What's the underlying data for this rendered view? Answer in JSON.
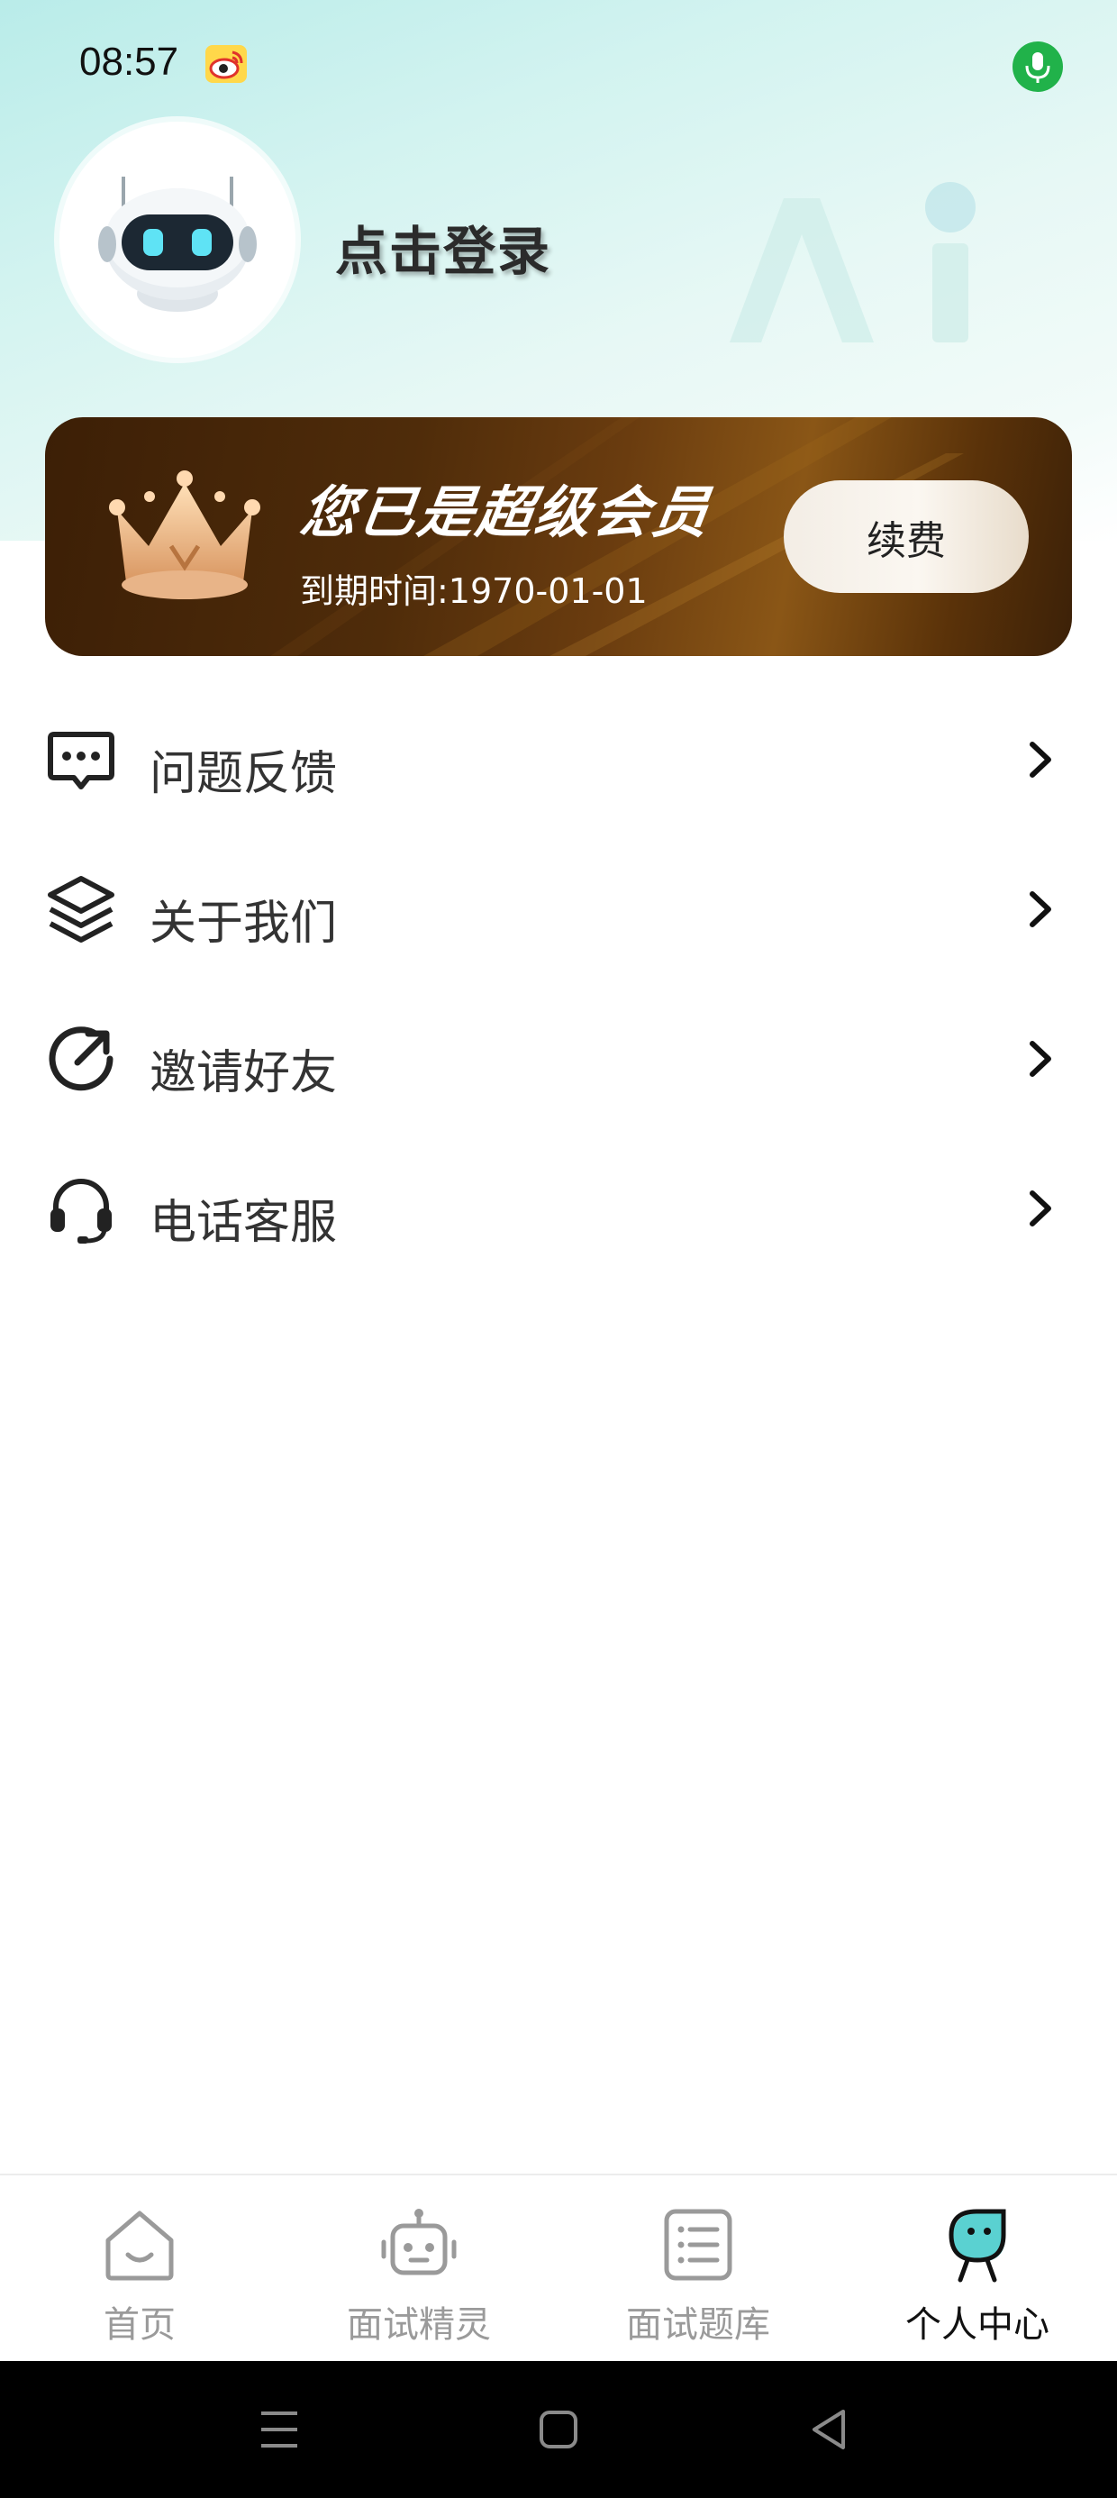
{
  "status_bar": {
    "time": "08:57",
    "icons": [
      "weibo-icon",
      "microphone-icon"
    ],
    "mic_color": "#21b24a"
  },
  "profile": {
    "avatar_icon": "robot-icon",
    "login_label": "点击登录"
  },
  "vip": {
    "crown_icon": "crown-icon",
    "title": "您已是超级会员",
    "expire_text": "到期时间:1970-01-01",
    "renew_label": "续费",
    "colors": {
      "card_dark": "#3c1f06",
      "card_gold": "#8a5616"
    }
  },
  "menu": {
    "items": [
      {
        "label": "问题反馈",
        "icon": "feedback-icon"
      },
      {
        "label": "关于我们",
        "icon": "layers-icon"
      },
      {
        "label": "邀请好友",
        "icon": "share-icon"
      },
      {
        "label": "电话客服",
        "icon": "headset-icon"
      }
    ],
    "chevron_icon": "chevron-right-icon"
  },
  "bottom_nav": {
    "items": [
      {
        "label": "首页",
        "icon": "home-icon",
        "active": false
      },
      {
        "label": "面试精灵",
        "icon": "robot-icon",
        "active": false
      },
      {
        "label": "面试题库",
        "icon": "list-icon",
        "active": false
      },
      {
        "label": "个人中心",
        "icon": "profile-icon",
        "active": true
      }
    ],
    "colors": {
      "inactive": "#9a9a9a",
      "active": "#111111",
      "accent": "#5ad1d1"
    }
  },
  "system_nav": {
    "buttons": [
      "menu-icon",
      "home-square-icon",
      "back-icon"
    ]
  }
}
